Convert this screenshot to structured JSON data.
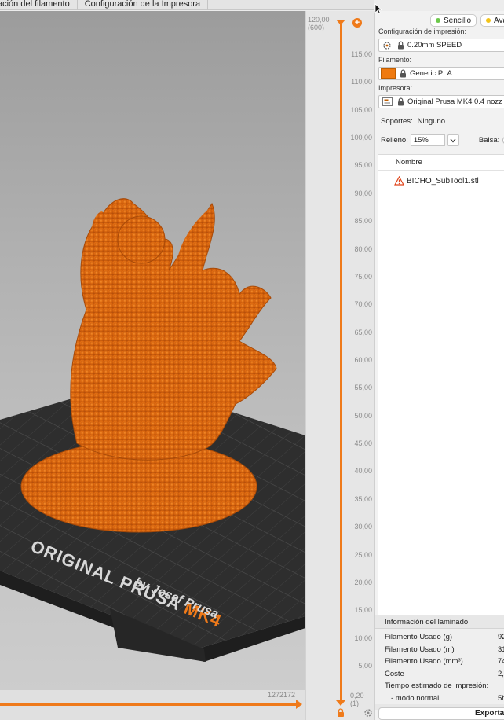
{
  "tabs": [
    "ación del filamento",
    "Configuración de la Impresora"
  ],
  "modes": [
    {
      "label": "Sencillo",
      "color": "#6cc84a"
    },
    {
      "label": "Ava",
      "color": "#f2c318"
    }
  ],
  "print_settings": {
    "label": "Configuración de impresión:",
    "value": "0.20mm SPEED",
    "icon": "print-settings-icon"
  },
  "filament": {
    "label": "Filamento:",
    "value": "Generic PLA",
    "color": "#ef7a10"
  },
  "printer": {
    "label": "Impresora:",
    "value": "Original Prusa MK4 0.4 nozz",
    "icon": "printer-icon"
  },
  "supports": {
    "label": "Soportes:",
    "value": "Ninguno"
  },
  "infill": {
    "label": "Relleno:",
    "value": "15%"
  },
  "brim": {
    "label": "Balsa:"
  },
  "object_list": {
    "header": "Nombre",
    "items": [
      {
        "name": "BICHO_SubTool1.stl",
        "icon": "warning-icon"
      }
    ]
  },
  "slice_info": {
    "title": "Información del laminado",
    "rows": [
      {
        "key": "Filamento Usado (g)",
        "value": "92"
      },
      {
        "key": "Filamento Usado (m)",
        "value": "31"
      },
      {
        "key": "Filamento Usado (mm³)",
        "value": "74"
      },
      {
        "key": "Coste",
        "value": "2,"
      },
      {
        "key": "Tiempo estimado de impresión:",
        "value": ""
      },
      {
        "key": "- modo normal",
        "value": "5h"
      }
    ]
  },
  "export_label": "Exporta",
  "layer_slider": {
    "top_value": "120,00",
    "top_layer": "(600)",
    "bottom_value": "0,20",
    "bottom_layer": "(1)",
    "ticks": [
      "115,00",
      "110,00",
      "105,00",
      "100,00",
      "95,00",
      "90,00",
      "85,00",
      "80,00",
      "75,00",
      "70,00",
      "65,00",
      "60,00",
      "55,00",
      "50,00",
      "45,00",
      "40,00",
      "35,00",
      "30,00",
      "25,00",
      "20,00",
      "15,00",
      "10,00",
      "5,00"
    ]
  },
  "move_slider": {
    "value": "1272172"
  },
  "bed": {
    "brand": "ORIGINAL PRUSA",
    "model": "MK4",
    "subtitle": "by Josef Prusa"
  },
  "accent_color": "#ef7a1a"
}
